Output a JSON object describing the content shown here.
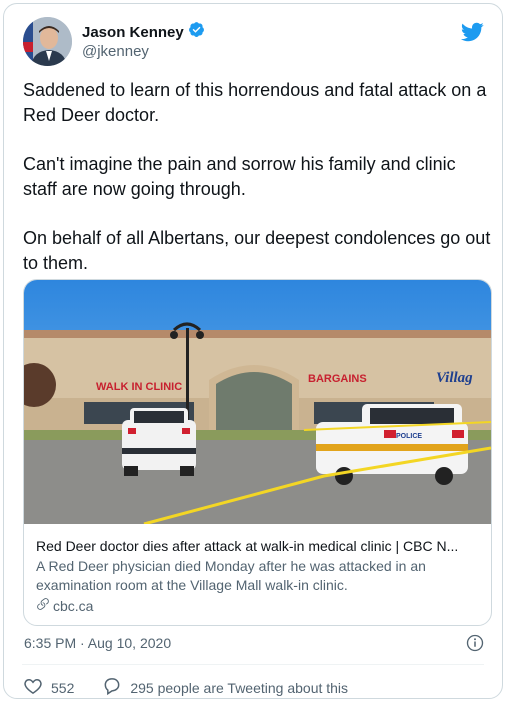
{
  "author": {
    "name": "Jason Kenney",
    "handle": "@jkenney",
    "verified": true
  },
  "tweet": {
    "paragraphs": [
      "Saddened to learn of this horrendous and fatal attack on a Red Deer doctor.",
      "Can't imagine the pain and sorrow his family and clinic staff are now going through.",
      "On behalf of all Albertans, our deepest condolences go out to them."
    ],
    "timestamp": "6:35 PM · Aug 10, 2020"
  },
  "link_card": {
    "title": "Red Deer doctor dies after attack at walk-in medical clinic | CBC N...",
    "description": "A Red Deer physician died Monday after he was attacked in an examination room at the Village Mall walk-in clinic.",
    "domain": "cbc.ca",
    "image_signs": {
      "walk_in": "WALK IN CLINIC",
      "store": "BARGAINS",
      "village": "Villag",
      "police": "POLICE"
    }
  },
  "footer": {
    "likes": "552",
    "tweeting": "295 people are Tweeting about this"
  },
  "colors": {
    "twitter_blue": "#1d9bf0",
    "text": "#0f1419",
    "muted": "#536471"
  },
  "icons": [
    "verified-badge-icon",
    "twitter-bird-icon",
    "link-icon",
    "info-icon",
    "heart-icon",
    "comment-bubble-icon"
  ]
}
